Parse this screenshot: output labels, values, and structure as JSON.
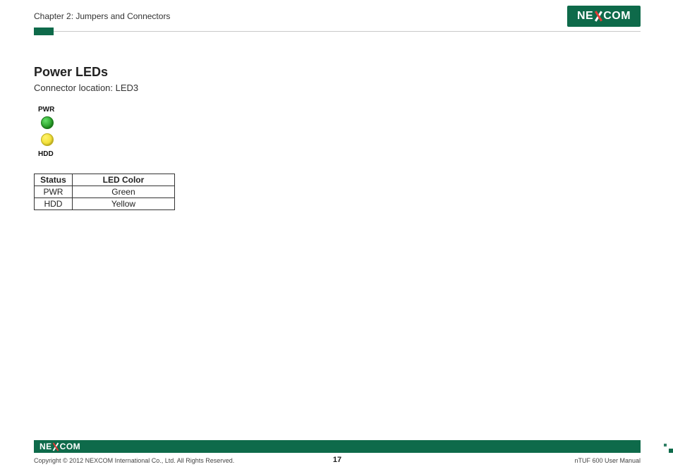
{
  "header": {
    "chapter_title": "Chapter 2: Jumpers and Connectors",
    "brand": {
      "left": "NE",
      "right": "COM"
    }
  },
  "content": {
    "section_title": "Power LEDs",
    "subtitle": "Connector location: LED3",
    "led_diagram": {
      "top_label": "PWR",
      "bottom_label": "HDD",
      "top_color": "#2aa02a",
      "bottom_color": "#f3e13a"
    },
    "table": {
      "headers": {
        "status": "Status",
        "color": "LED Color"
      },
      "rows": [
        {
          "status": "PWR",
          "color": "Green"
        },
        {
          "status": "HDD",
          "color": "Yellow"
        }
      ]
    }
  },
  "footer": {
    "brand": {
      "left": "NE",
      "right": "COM"
    },
    "copyright": "Copyright © 2012 NEXCOM International Co., Ltd. All Rights Reserved.",
    "page_number": "17",
    "doc_name": "nTUF 600 User Manual"
  }
}
